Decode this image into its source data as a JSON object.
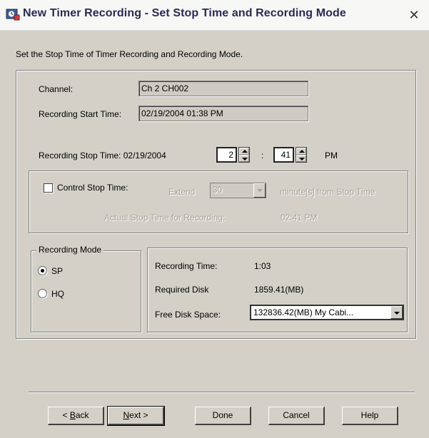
{
  "window": {
    "title": "New Timer Recording - Set Stop Time and Recording Mode",
    "close_glyph": "✕"
  },
  "instructions": "Set the Stop Time of Timer Recording and Recording Mode.",
  "channel": {
    "label": "Channel:",
    "value": "Ch 2 CH002"
  },
  "start_time": {
    "label": "Recording Start Time:",
    "value": "02/19/2004 01:38 PM"
  },
  "stop_time": {
    "label": "Recording Stop Time: 02/19/2004",
    "hour": "2",
    "separator": ":",
    "minute": "41",
    "ampm": "PM"
  },
  "control_stop": {
    "checkbox_label": "Control Stop Time:",
    "checked": false,
    "extend_label": "Extend",
    "extend_value": "30",
    "extend_suffix": "minute[s] from Stop Time",
    "actual_label": "Actual Stop Time for Recording:",
    "actual_value": "02:41 PM"
  },
  "recording_mode": {
    "title": "Recording Mode",
    "options": [
      {
        "label": "SP",
        "selected": true
      },
      {
        "label": "HQ",
        "selected": false
      }
    ]
  },
  "info": {
    "recording_time_label": "Recording Time:",
    "recording_time_value": "1:03",
    "required_disk_label": "Required Disk",
    "required_disk_value": "1859.41(MB)",
    "free_space_label": "Free Disk Space:",
    "free_space_value": "132836.42(MB) My Cabi..."
  },
  "buttons": {
    "back_prefix": "< ",
    "back_mnemonic": "B",
    "back_rest": "ack",
    "next_mnemonic": "N",
    "next_rest": "ext >",
    "done": "Done",
    "cancel": "Cancel",
    "help": "Help"
  },
  "icons": {
    "app": "timer-recording-app-icon",
    "close": "close-icon",
    "dropdown": "chevron-down-icon",
    "spin": "spin-arrows-icon"
  }
}
